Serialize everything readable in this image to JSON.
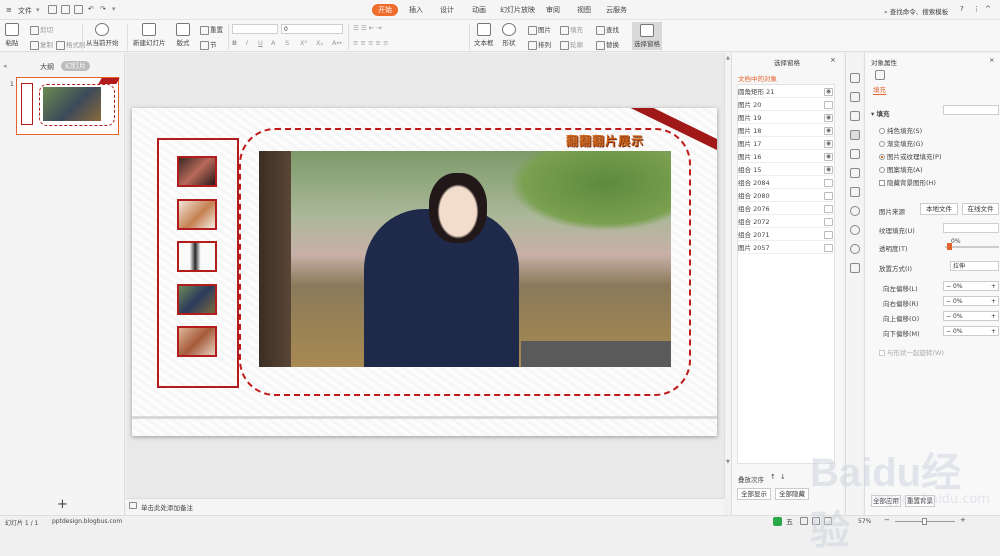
{
  "titlebar": {
    "file_menu": "文件",
    "tabs": [
      "开始",
      "插入",
      "设计",
      "动画",
      "幻灯片放映",
      "审阅",
      "视图",
      "云服务"
    ],
    "active_tab": "开始",
    "search": "查找命令、搜索模板"
  },
  "ribbon": {
    "paste": "粘贴",
    "cut": "剪切",
    "copy": "复制",
    "format_painter": "格式刷",
    "start_from_current": "从当前开始",
    "new_slide": "新建幻灯片",
    "layout": "版式",
    "reset": "重置",
    "section": "节",
    "font_size": "0",
    "textbox": "文本框",
    "shape": "形状",
    "picture": "图片",
    "arrange": "排列",
    "fill": "填充",
    "outline": "轮廓",
    "find": "查找",
    "replace": "替换",
    "select_pane": "选择窗格"
  },
  "leftpane": {
    "tab_outline": "大纲",
    "tab_slides": "幻灯片",
    "slide_number": "1",
    "add_icon": "+"
  },
  "slide": {
    "title_text": "翻翻翻片展示",
    "accent_color": "#b31c1c"
  },
  "notes": {
    "placeholder": "单击此处添加备注"
  },
  "selection_pane": {
    "title": "选择窗格",
    "section_label": "文档中的对象",
    "objects": [
      "圆角矩形 21",
      "图片 20",
      "图片 19",
      "图片 18",
      "图片 17",
      "图片 16",
      "组合 15",
      "组合 2084",
      "组合 2080",
      "组合 2076",
      "组合 2072",
      "组合 2071",
      "图片 2057"
    ],
    "order_label": "叠放次序",
    "show_all": "全部显示",
    "hide_all": "全部隐藏"
  },
  "properties": {
    "title": "对象属性",
    "tab_fill": "填充",
    "fill_section": "填充",
    "options": [
      "纯色填充(S)",
      "渐变填充(G)",
      "图片或纹理填充(P)",
      "图案填充(A)"
    ],
    "selected_option": "图片或纹理填充(P)",
    "hide_bg": "隐藏背景图形(H)",
    "picture_source": "图片来源",
    "local_file": "本地文件",
    "online_file": "在线文件",
    "texture_fill": "纹理填充(U)",
    "transparency": "透明度(T)",
    "transparency_value": "0%",
    "placement": "放置方式(I)",
    "placement_value": "拉伸",
    "offset_left": "向左偏移(L)",
    "offset_right": "向右偏移(R)",
    "offset_top": "向上偏移(O)",
    "offset_bottom": "向下偏移(M)",
    "offset_value": "0%",
    "rotate_with_shape": "与形状一起旋转(W)",
    "apply_all": "全部应用",
    "reset_bg": "重置背景"
  },
  "statusbar": {
    "slide_info": "幻灯片 1 / 1",
    "theme": "pptdesign.blogbus.com",
    "zoom": "57%"
  },
  "watermark": {
    "text": "Baidu经验",
    "url": "jingyan.baidu.com"
  }
}
